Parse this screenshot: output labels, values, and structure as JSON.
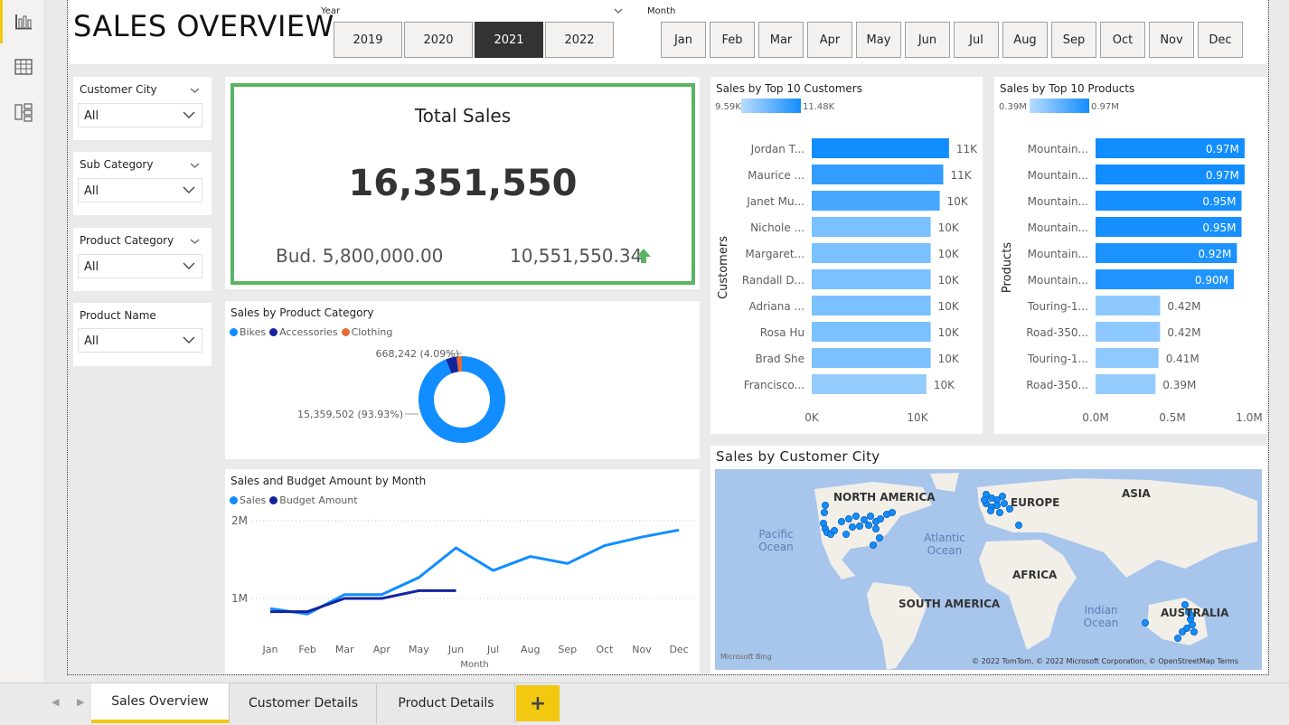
{
  "nav": {
    "icons": [
      "report-icon",
      "table-icon",
      "model-icon"
    ]
  },
  "header": {
    "title": "SALES OVERVIEW",
    "year_label": "Year",
    "month_label": "Month",
    "years": [
      "2019",
      "2020",
      "2021",
      "2022"
    ],
    "selected_year": "2021",
    "months": [
      "Jan",
      "Feb",
      "Mar",
      "Apr",
      "May",
      "Jun",
      "Jul",
      "Aug",
      "Sep",
      "Oct",
      "Nov",
      "Dec"
    ]
  },
  "slicers": [
    {
      "label": "Customer City",
      "value": "All"
    },
    {
      "label": "Sub Category",
      "value": "All"
    },
    {
      "label": "Product Category",
      "value": "All"
    },
    {
      "label": "Product Name",
      "value": "All"
    }
  ],
  "kpi": {
    "title": "Total Sales",
    "value": "16,351,550",
    "budget": "Bud. 5,800,000.00",
    "variance": "10,551,550.34",
    "accent": "#5bb463"
  },
  "category_chart": {
    "title": "Sales by Product Category",
    "legend": [
      {
        "name": "Bikes",
        "color": "#118dff"
      },
      {
        "name": "Accessories",
        "color": "#12239e"
      },
      {
        "name": "Clothing",
        "color": "#e66c37"
      }
    ],
    "label_small": "668,242 (4.09%)",
    "label_large": "15,359,502 (93.93%)"
  },
  "line_chart": {
    "title": "Sales and Budget Amount by Month",
    "xlabel": "Month",
    "legend": [
      {
        "name": "Sales",
        "color": "#118dff"
      },
      {
        "name": "Budget Amount",
        "color": "#12239e"
      }
    ]
  },
  "customers_chart": {
    "title": "Sales by Top 10 Customers",
    "scale_min": "9.59K",
    "scale_max": "11.48K",
    "axis_title": "Customers",
    "ticks": [
      "0K",
      "10K"
    ]
  },
  "products_chart": {
    "title": "Sales by Top 10 Products",
    "scale_min": "0.39M",
    "scale_max": "0.97M",
    "axis_title": "Products",
    "ticks": [
      "0.0M",
      "0.5M",
      "1.0M"
    ]
  },
  "map": {
    "title": "Sales by Customer City",
    "labels": {
      "na": "NORTH AMERICA",
      "eu": "EUROPE",
      "asia": "ASIA",
      "africa": "AFRICA",
      "sa": "SOUTH AMERICA",
      "au": "AUSTRALIA"
    },
    "oceans": {
      "pacific": "Pacific Ocean",
      "atlantic": "Atlantic Ocean",
      "indian": "Indian Ocean"
    },
    "bing": "Microsoft Bing",
    "copyright": "© 2022 TomTom, © 2022 Microsoft Corporation, © OpenStreetMap  Terms"
  },
  "tabs": [
    {
      "label": "Sales Overview",
      "active": true
    },
    {
      "label": "Customer Details",
      "active": false
    },
    {
      "label": "Product Details",
      "active": false
    }
  ],
  "add_tab": "+",
  "chart_data": [
    {
      "type": "pie",
      "title": "Sales by Product Category",
      "categories": [
        "Bikes",
        "Accessories",
        "Clothing"
      ],
      "values": [
        15359502,
        668242,
        323806
      ]
    },
    {
      "type": "line",
      "title": "Sales and Budget Amount by Month",
      "x": [
        "Jan",
        "Feb",
        "Mar",
        "Apr",
        "May",
        "Jun",
        "Jul",
        "Aug",
        "Sep",
        "Oct",
        "Nov",
        "Dec"
      ],
      "yticks": [
        "1M",
        "2M"
      ],
      "ylim": [
        0,
        2000000
      ],
      "series": [
        {
          "name": "Sales",
          "values": [
            870000,
            800000,
            1050000,
            1050000,
            1270000,
            1650000,
            1360000,
            1540000,
            1450000,
            1680000,
            1790000,
            1880000
          ]
        },
        {
          "name": "Budget Amount",
          "values": [
            830000,
            830000,
            1000000,
            1000000,
            1100000,
            1100000,
            null,
            null,
            null,
            null,
            null,
            null
          ]
        }
      ]
    },
    {
      "type": "bar",
      "title": "Sales by Top 10 Customers",
      "xlim": [
        0,
        13000
      ],
      "categories": [
        "Jordan T...",
        "Maurice ...",
        "Janet Mu...",
        "Nichole ...",
        "Margaret...",
        "Randall D...",
        "Adriana ...",
        "Rosa Hu",
        "Brad She",
        "Francisco..."
      ],
      "values": [
        11480,
        11000,
        10700,
        9950,
        9950,
        9950,
        9950,
        9950,
        9950,
        9590
      ],
      "labels": [
        "11K",
        "11K",
        "10K",
        "10K",
        "10K",
        "10K",
        "10K",
        "10K",
        "10K",
        "10K"
      ]
    },
    {
      "type": "bar",
      "title": "Sales by Top 10 Products",
      "xlim": [
        0,
        1.0
      ],
      "categories": [
        "Mountain...",
        "Mountain...",
        "Mountain...",
        "Mountain...",
        "Mountain...",
        "Mountain...",
        "Touring-1...",
        "Road-350...",
        "Touring-1...",
        "Road-350..."
      ],
      "values": [
        0.97,
        0.97,
        0.95,
        0.95,
        0.92,
        0.9,
        0.42,
        0.42,
        0.41,
        0.39
      ],
      "labels": [
        "0.97M",
        "0.97M",
        "0.95M",
        "0.95M",
        "0.92M",
        "0.90M",
        "0.42M",
        "0.42M",
        "0.41M",
        "0.39M"
      ]
    }
  ]
}
